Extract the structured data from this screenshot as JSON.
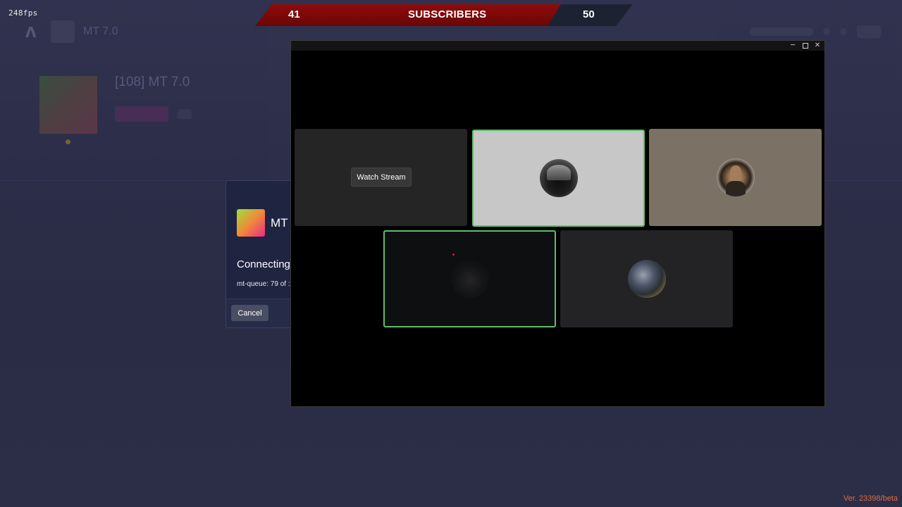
{
  "overlay": {
    "fps": "248fps",
    "version": "Ver. 23398/beta"
  },
  "subscriber_banner": {
    "left_count": "41",
    "label": "SUBSCRIBERS",
    "right_count": "50"
  },
  "background_app": {
    "header_title": "MT 7.0",
    "server_title": "[108] MT 7.0"
  },
  "connecting_dialog": {
    "server_name": "MT",
    "status": "Connecting",
    "queue": "mt-queue: 79 of :",
    "cancel_label": "Cancel"
  },
  "call_window": {
    "watch_stream_label": "Watch Stream",
    "controls": {
      "minimize": "─",
      "close": "✕"
    }
  },
  "colors": {
    "speaking_outline": "#5fbe6a",
    "banner_red": "#8e0c0c",
    "version_text": "#e06a3a"
  }
}
